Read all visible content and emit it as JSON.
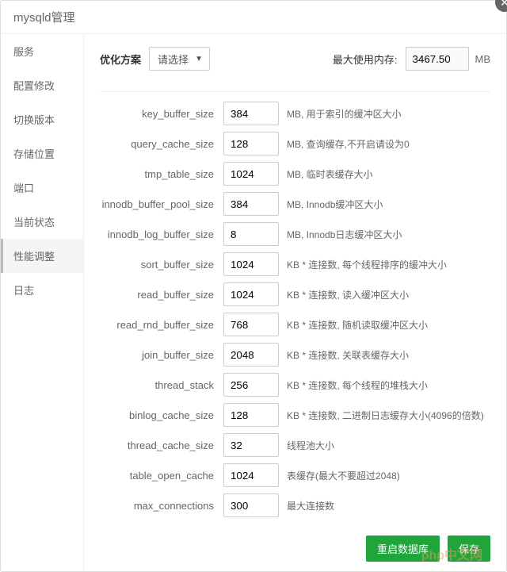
{
  "title": "mysqld管理",
  "sidebar": {
    "items": [
      {
        "label": "服务"
      },
      {
        "label": "配置修改"
      },
      {
        "label": "切换版本"
      },
      {
        "label": "存储位置"
      },
      {
        "label": "端口"
      },
      {
        "label": "当前状态"
      },
      {
        "label": "性能调整"
      },
      {
        "label": "日志"
      }
    ],
    "activeIndex": 6
  },
  "top": {
    "plan_label": "优化方案",
    "plan_value": "请选择",
    "mem_label": "最大使用内存:",
    "mem_value": "3467.50",
    "mem_unit": "MB"
  },
  "settings": [
    {
      "key": "key_buffer_size",
      "value": "384",
      "desc": "MB, 用于索引的缓冲区大小"
    },
    {
      "key": "query_cache_size",
      "value": "128",
      "desc": "MB, 查询缓存,不开启请设为0"
    },
    {
      "key": "tmp_table_size",
      "value": "1024",
      "desc": "MB, 临时表缓存大小"
    },
    {
      "key": "innodb_buffer_pool_size",
      "value": "384",
      "desc": "MB, Innodb缓冲区大小"
    },
    {
      "key": "innodb_log_buffer_size",
      "value": "8",
      "desc": "MB, Innodb日志缓冲区大小"
    },
    {
      "key": "sort_buffer_size",
      "value": "1024",
      "desc": "KB * 连接数, 每个线程排序的缓冲大小"
    },
    {
      "key": "read_buffer_size",
      "value": "1024",
      "desc": "KB * 连接数, 读入缓冲区大小"
    },
    {
      "key": "read_rnd_buffer_size",
      "value": "768",
      "desc": "KB * 连接数, 随机读取缓冲区大小"
    },
    {
      "key": "join_buffer_size",
      "value": "2048",
      "desc": "KB * 连接数, 关联表缓存大小"
    },
    {
      "key": "thread_stack",
      "value": "256",
      "desc": "KB * 连接数, 每个线程的堆栈大小"
    },
    {
      "key": "binlog_cache_size",
      "value": "128",
      "desc": "KB * 连接数, 二进制日志缓存大小(4096的倍数)"
    },
    {
      "key": "thread_cache_size",
      "value": "32",
      "desc": "线程池大小"
    },
    {
      "key": "table_open_cache",
      "value": "1024",
      "desc": "表缓存(最大不要超过2048)"
    },
    {
      "key": "max_connections",
      "value": "300",
      "desc": "最大连接数"
    }
  ],
  "footer": {
    "restart_label": "重启数据库",
    "save_label": "保存"
  },
  "watermark": "php中文网"
}
